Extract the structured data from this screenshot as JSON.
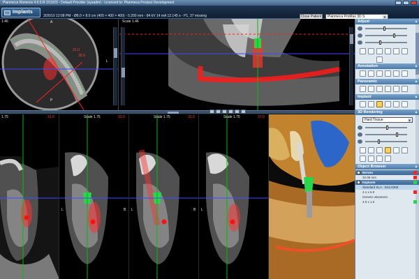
{
  "window": {
    "title": "Planmeca Romexis 4.0.0.R 2/13/23 - Default Provider (sysadm) - Licensed to: Planmeca Product Development"
  },
  "toolbar": {
    "tab_label": "Implants",
    "info": "3/26/10 12:08 PM - Ø8.0 × 8.0 cm (400 × 400 × 400) - 0.200 mm - 84 kV 14 mA 12.145 s - P1, 37 missing",
    "close_patient_label": "Close Patient",
    "device_label": "Planmeca ProMax 3D S"
  },
  "views": {
    "axial": {
      "scale": "1.46",
      "label_a": "A",
      "label_p": "P",
      "label_l": "L",
      "meas_1": "31.0",
      "meas_2": "35.0"
    },
    "panoramic": {
      "scale": "Scale 1.46"
    },
    "cross": [
      {
        "scale": "1.75",
        "slice": "31.0"
      },
      {
        "scale": "Scale 1.75",
        "slice": "31.0"
      },
      {
        "scale": "Scale 1.75",
        "slice": "31.0"
      },
      {
        "scale": "Scale 1.75",
        "slice": "37.0"
      }
    ],
    "side_l": "L",
    "side_b": "B"
  },
  "panel": {
    "sections": {
      "adjust": "Adjust",
      "annotation": "Annotation",
      "panoramic": "Panoramic",
      "implant": "Implant",
      "rendering": "3D Rendering",
      "object_browser": "Object Browser"
    },
    "rendering_mode": "Hard Tissue",
    "object_browser": {
      "rows": [
        {
          "label": "Nerves",
          "type": "group"
        },
        {
          "label": "32.08 mm",
          "type": "item"
        },
        {
          "label": "Implants",
          "type": "group"
        },
        {
          "label": "Standard SLA · D43.6305",
          "type": "item"
        },
        {
          "label": "4.1 x 6.0",
          "type": "item"
        },
        {
          "label": "Generic abutment",
          "type": "item"
        },
        {
          "label": "4.0 x 1.0",
          "type": "item"
        }
      ]
    }
  },
  "colors": {
    "implant_green": "#27d64a",
    "nerve_red": "#ff2020",
    "guide_green": "#00c000",
    "axis_blue": "#3a4cff",
    "panel_header": "#4b7aa8"
  },
  "icons": [
    "implant-icon",
    "minimize-icon",
    "maximize-icon",
    "close-icon",
    "chevron-down-icon"
  ]
}
